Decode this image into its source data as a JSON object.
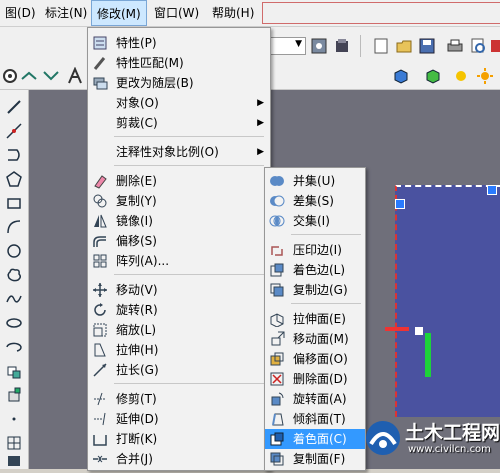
{
  "menubar": {
    "items": [
      {
        "label": "图(D)"
      },
      {
        "label": "标注(N)"
      },
      {
        "label": "修改(M)"
      },
      {
        "label": "窗口(W)"
      },
      {
        "label": "帮助(H)"
      }
    ]
  },
  "modify_menu": {
    "items": [
      {
        "label": "特性(P)"
      },
      {
        "label": "特性匹配(M)"
      },
      {
        "label": "更改为随层(B)"
      },
      {
        "label": "对象(O)"
      },
      {
        "label": "剪裁(C)"
      },
      {
        "label": "注释性对象比例(O)"
      },
      {
        "label": "删除(E)"
      },
      {
        "label": "复制(Y)"
      },
      {
        "label": "镜像(I)"
      },
      {
        "label": "偏移(S)"
      },
      {
        "label": "阵列(A)..."
      },
      {
        "label": "移动(V)"
      },
      {
        "label": "旋转(R)"
      },
      {
        "label": "缩放(L)"
      },
      {
        "label": "拉伸(H)"
      },
      {
        "label": "拉长(G)"
      },
      {
        "label": "修剪(T)"
      },
      {
        "label": "延伸(D)"
      },
      {
        "label": "打断(K)"
      },
      {
        "label": "合并(J)"
      }
    ]
  },
  "solid_edit_menu": {
    "items": [
      {
        "label": "并集(U)"
      },
      {
        "label": "差集(S)"
      },
      {
        "label": "交集(I)"
      },
      {
        "label": "压印边(I)"
      },
      {
        "label": "着色边(L)"
      },
      {
        "label": "复制边(G)"
      },
      {
        "label": "拉伸面(E)"
      },
      {
        "label": "移动面(M)"
      },
      {
        "label": "偏移面(O)"
      },
      {
        "label": "删除面(D)"
      },
      {
        "label": "旋转面(A)"
      },
      {
        "label": "倾斜面(T)"
      },
      {
        "label": "着色面(C)"
      },
      {
        "label": "复制面(F)"
      }
    ]
  },
  "watermark": {
    "title": "土木工程网",
    "url": "www.civilcn.com"
  },
  "colors": {
    "highlight": "#3399ff",
    "menu_bg": "#f2f2f2",
    "workspace": "#6f6f7a",
    "model": "#4a52a0"
  }
}
